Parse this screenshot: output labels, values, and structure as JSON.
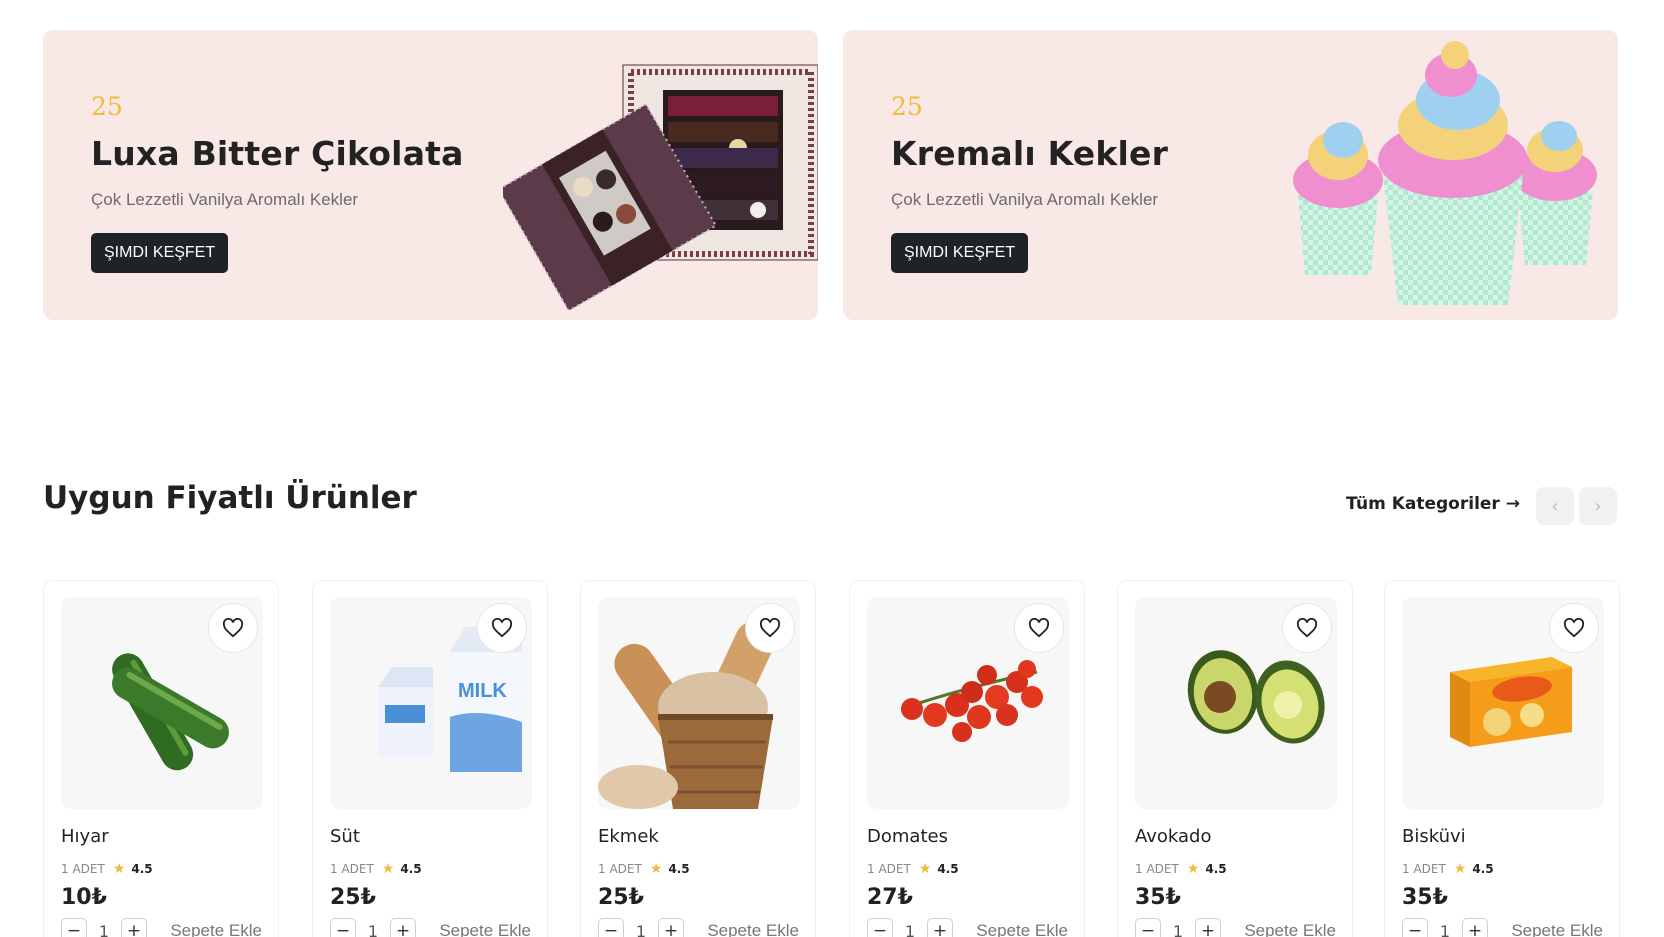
{
  "banners": [
    {
      "number": "25",
      "title": "Luxa Bitter Çikolata",
      "subtitle": "Çok Lezzetli Vanilya Aromalı Kekler",
      "button": "ŞIMDI KEŞFET"
    },
    {
      "number": "25",
      "title": "Kremalı Kekler",
      "subtitle": "Çok Lezzetli Vanilya Aromalı Kekler",
      "button": "ŞIMDI KEŞFET"
    }
  ],
  "section": {
    "title": "Uygun Fiyatlı Ürünler",
    "all_categories": "Tüm Kategoriler →",
    "prev_icon": "chevron-left-icon",
    "next_icon": "chevron-right-icon"
  },
  "products": [
    {
      "name": "Hıyar",
      "unit": "1 ADET",
      "rating": "4.5",
      "price": "10₺",
      "qty": "1",
      "add": "Sepete Ekle"
    },
    {
      "name": "Süt",
      "unit": "1 ADET",
      "rating": "4.5",
      "price": "25₺",
      "qty": "1",
      "add": "Sepete Ekle"
    },
    {
      "name": "Ekmek",
      "unit": "1 ADET",
      "rating": "4.5",
      "price": "25₺",
      "qty": "1",
      "add": "Sepete Ekle"
    },
    {
      "name": "Domates",
      "unit": "1 ADET",
      "rating": "4.5",
      "price": "27₺",
      "qty": "1",
      "add": "Sepete Ekle"
    },
    {
      "name": "Avokado",
      "unit": "1 ADET",
      "rating": "4.5",
      "price": "35₺",
      "qty": "1",
      "add": "Sepete Ekle"
    },
    {
      "name": "Bisküvi",
      "unit": "1 ADET",
      "rating": "4.5",
      "price": "35₺",
      "qty": "1",
      "add": "Sepete Ekle"
    }
  ],
  "colors": {
    "banner_bg": "#f9e9e6",
    "accent_number": "#f2b93a",
    "button_dark": "#1f2327",
    "star": "#f2b93a"
  }
}
